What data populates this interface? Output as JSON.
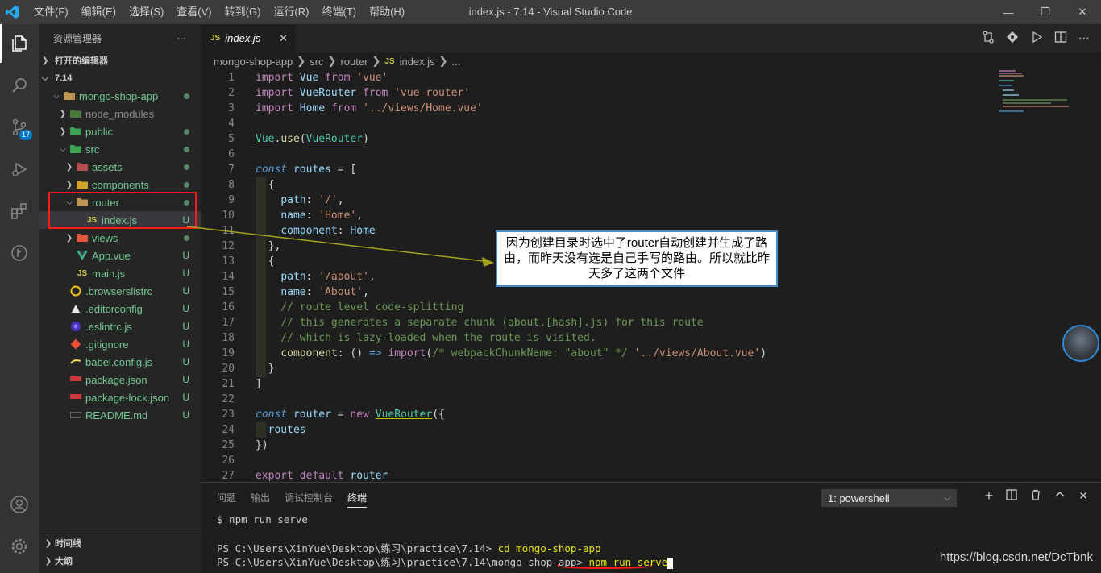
{
  "window": {
    "title": "index.js - 7.14 - Visual Studio Code",
    "menu": [
      "文件(F)",
      "编辑(E)",
      "选择(S)",
      "查看(V)",
      "转到(G)",
      "运行(R)",
      "终端(T)",
      "帮助(H)"
    ]
  },
  "activity": {
    "scm_badge": "17"
  },
  "sidebar": {
    "header": "资源管理器",
    "more": "···",
    "open_editors": "打开的编辑器",
    "root": "7.14",
    "items": [
      {
        "label": "mongo-shop-app",
        "status": ""
      },
      {
        "label": "node_modules",
        "status": ""
      },
      {
        "label": "public",
        "status": ""
      },
      {
        "label": "src",
        "status": ""
      },
      {
        "label": "assets",
        "status": ""
      },
      {
        "label": "components",
        "status": ""
      },
      {
        "label": "router",
        "status": ""
      },
      {
        "label": "index.js",
        "status": "U",
        "icon": "JS"
      },
      {
        "label": "views",
        "status": ""
      },
      {
        "label": "App.vue",
        "status": "U"
      },
      {
        "label": "main.js",
        "status": "U",
        "icon": "JS"
      },
      {
        "label": ".browserslistrc",
        "status": "U"
      },
      {
        "label": ".editorconfig",
        "status": "U"
      },
      {
        "label": ".eslintrc.js",
        "status": "U"
      },
      {
        "label": ".gitignore",
        "status": "U"
      },
      {
        "label": "babel.config.js",
        "status": "U"
      },
      {
        "label": "package.json",
        "status": "U"
      },
      {
        "label": "package-lock.json",
        "status": "U"
      },
      {
        "label": "README.md",
        "status": "U"
      }
    ],
    "timeline": "时间线",
    "outline": "大纲"
  },
  "editor": {
    "tab": {
      "icon": "JS",
      "label": "index.js",
      "close": "✕"
    },
    "breadcrumb": [
      "mongo-shop-app",
      "src",
      "router",
      "index.js",
      "..."
    ],
    "breadcrumb_icon": "JS"
  },
  "annotation": {
    "text": "因为创建目录时选中了router自动创建并生成了路由，而昨天没有选是自己手写的路由。所以就比昨天多了这两个文件"
  },
  "panel": {
    "tabs": [
      "问题",
      "输出",
      "调试控制台",
      "终端"
    ],
    "active_tab": "终端",
    "terminal_select": "1: powershell",
    "lines": [
      {
        "text": "$ npm run serve"
      },
      {
        "text": "PS C:\\Users\\XinYue\\Desktop\\练习\\practice\\7.14> ",
        "cmd": "cd mongo-shop-app"
      },
      {
        "text": "PS C:\\Users\\XinYue\\Desktop\\练习\\practice\\7.14\\mongo-shop-app> ",
        "cmd": "npm run serve"
      }
    ]
  },
  "watermark": "https://blog.csdn.net/DcTbnk"
}
